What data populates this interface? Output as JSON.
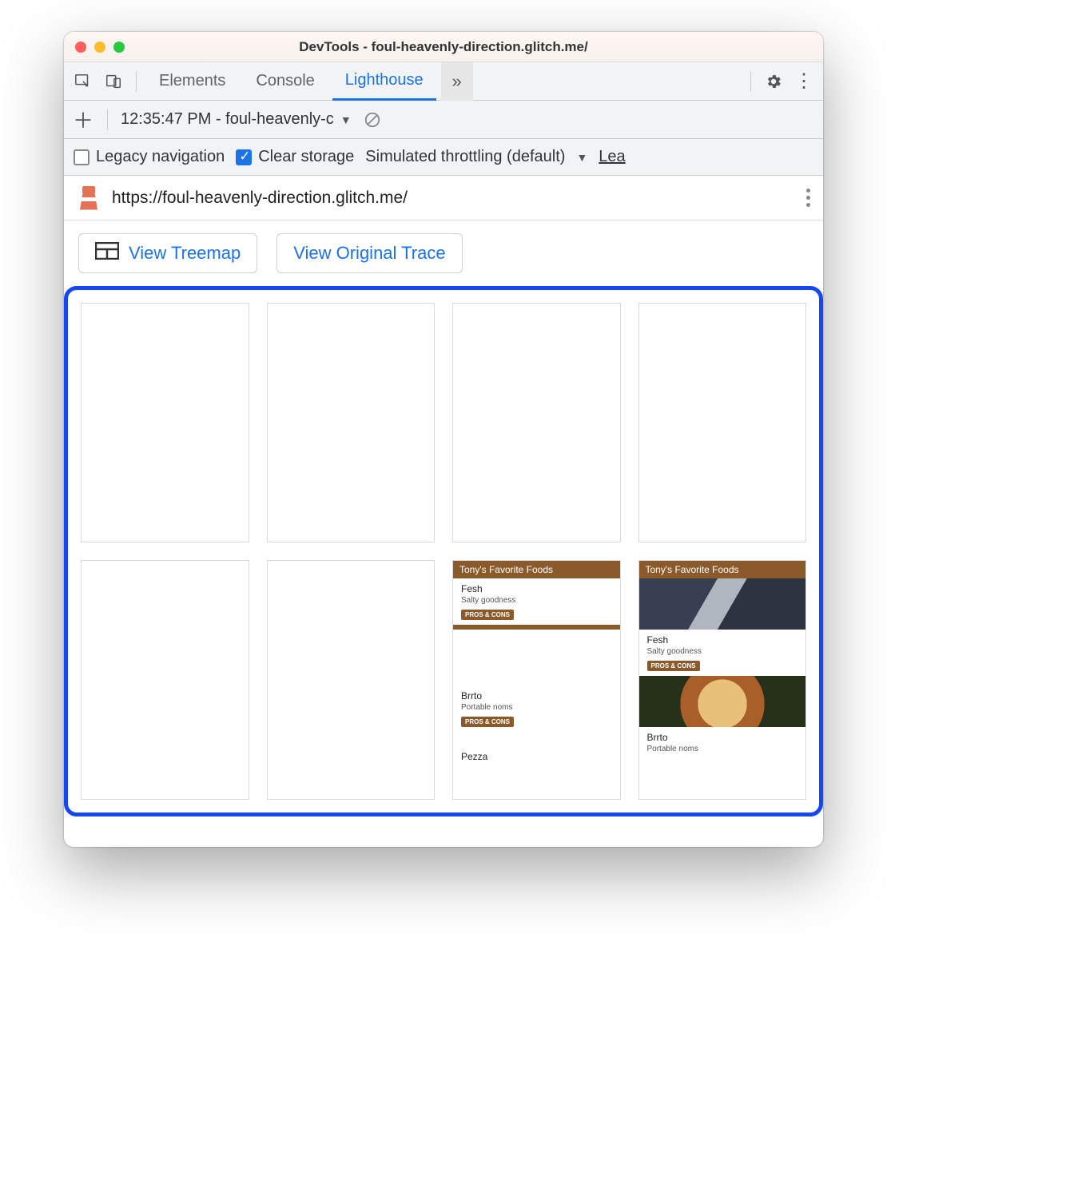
{
  "window": {
    "title": "DevTools - foul-heavenly-direction.glitch.me/"
  },
  "tabs": {
    "elements": "Elements",
    "console": "Console",
    "lighthouse": "Lighthouse",
    "overflow": "»"
  },
  "reportbar": {
    "dropdown": "12:35:47 PM - foul-heavenly-c"
  },
  "options": {
    "legacy": "Legacy navigation",
    "clear": "Clear storage",
    "throttle": "Simulated throttling (default)",
    "lea": "Lea"
  },
  "url": "https://foul-heavenly-direction.glitch.me/",
  "actions": {
    "treemap": "View Treemap",
    "trace": "View Original Trace"
  },
  "filmstrip": {
    "header": "Tony's Favorite Foods",
    "food1": {
      "title": "Fesh",
      "sub": "Salty goodness"
    },
    "food2": {
      "title": "Brrto",
      "sub": "Portable noms"
    },
    "food3": {
      "title": "Pezza"
    },
    "pcbtn": "PROS & CONS"
  }
}
